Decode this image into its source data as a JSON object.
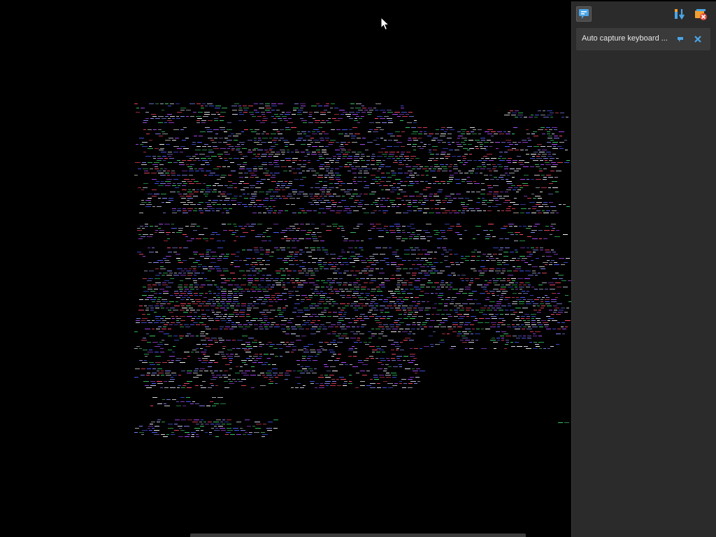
{
  "panel": {
    "toolbar": {
      "chat_icon": "chat-bubble-icon",
      "sort_icon": "sort-icon",
      "clear_icon": "clear-all-icon"
    },
    "notification": {
      "text": "Auto capture keyboard ...",
      "pin_icon": "pin-icon",
      "close_icon": "close-icon"
    }
  },
  "colors": {
    "panel_bg": "#2b2b2b",
    "notification_bg": "#3a3a3a",
    "accent_blue": "#4aa6e8",
    "accent_orange": "#f0a030",
    "glitch_palette": [
      "#4a5cff",
      "#b04aff",
      "#ff4a6a",
      "#3acf6a",
      "#e0e0ff",
      "#8a8aff",
      "#ffffff"
    ]
  }
}
